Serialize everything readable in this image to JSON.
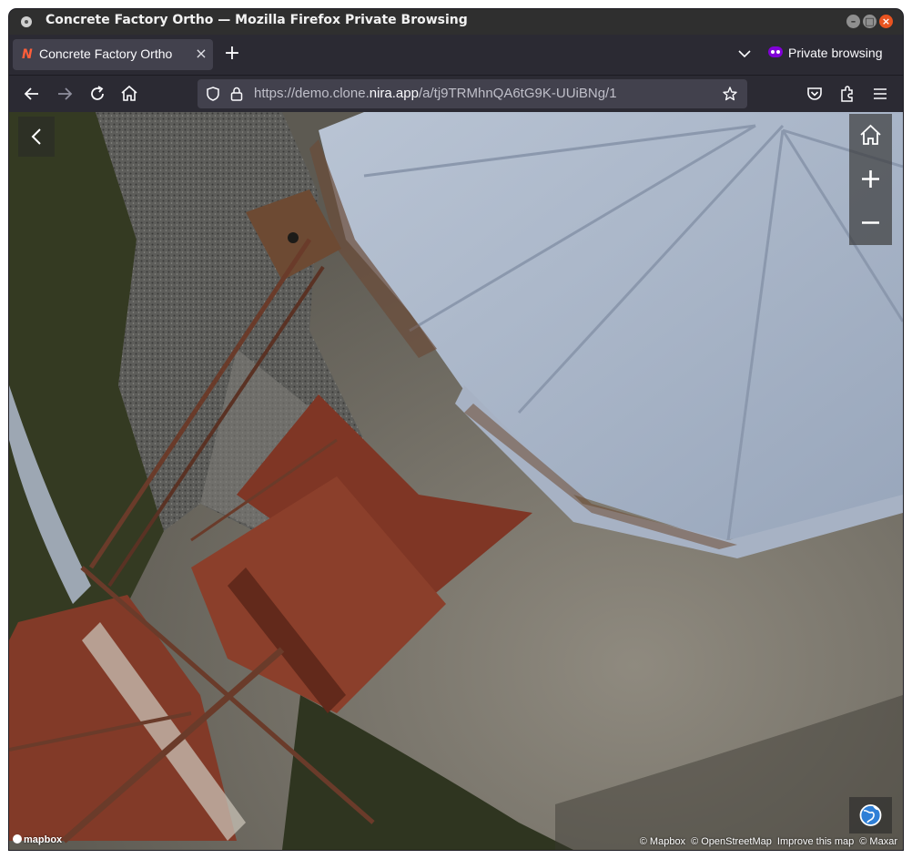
{
  "window": {
    "title": "Concrete Factory Ortho — Mozilla Firefox Private Browsing",
    "controls": {
      "minimize": "–",
      "maximize": "□",
      "close": "×"
    }
  },
  "tabs": [
    {
      "label": "Concrete Factory Ortho",
      "favicon": "nira-logo-icon",
      "close": "×",
      "active": true
    }
  ],
  "tabstrip": {
    "new_tab": "+",
    "private_label": "Private browsing"
  },
  "nav": {
    "url_prefix": "https://demo.clone.",
    "url_host": "nira.app",
    "url_path": "/a/tj9TRMhnQA6tG9K-UUiBNg/1"
  },
  "map": {
    "attribution": [
      "© Mapbox",
      "© OpenStreetMap",
      "Improve this map",
      "© Maxar"
    ],
    "logo_text": "mapbox"
  },
  "colors": {
    "accent_close": "#e95420",
    "private_purple": "#8000d7",
    "favicon": "#ff5e3a",
    "roof_blue": "#a9b6c9",
    "rust": "#8a3b26"
  }
}
